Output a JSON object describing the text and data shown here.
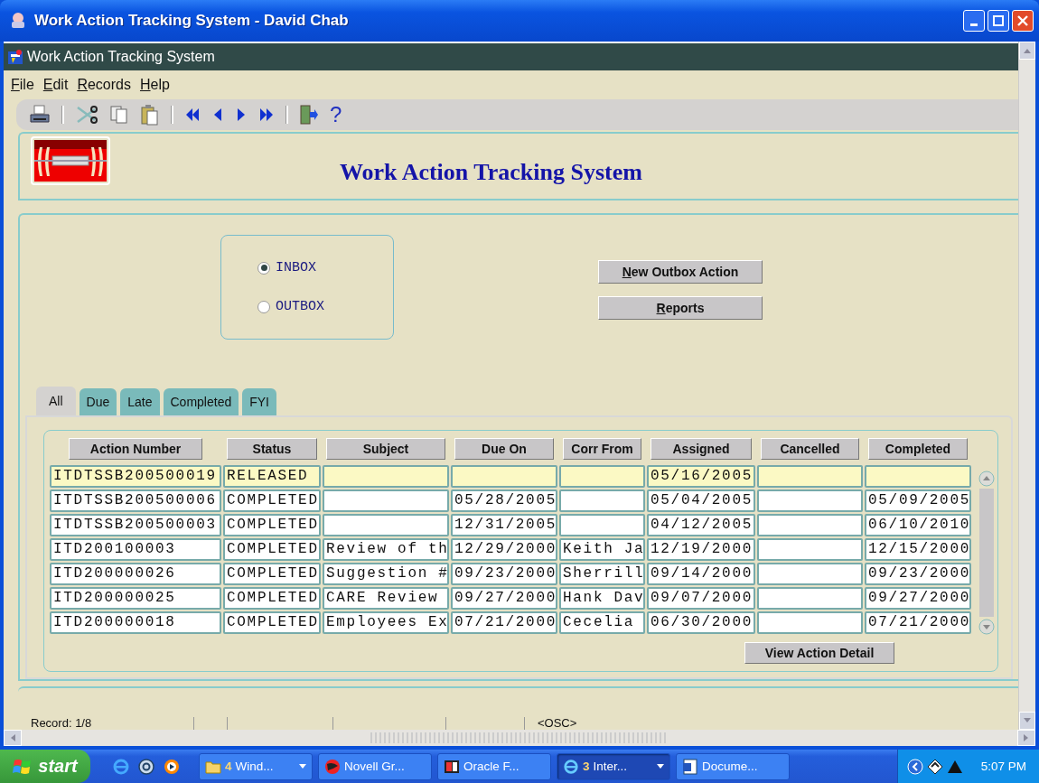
{
  "window": {
    "title": "Work Action Tracking System - David Chab"
  },
  "inner_window": {
    "title": "Work Action Tracking System"
  },
  "menu": [
    "File",
    "Edit",
    "Records",
    "Help"
  ],
  "toolbar": {
    "help_glyph": "?"
  },
  "header": {
    "title": "Work Action Tracking System"
  },
  "mailbox": [
    {
      "label": "INBOX",
      "selected": true
    },
    {
      "label": "OUTBOX",
      "selected": false
    }
  ],
  "buttons": [
    "New Outbox Action",
    "Reports"
  ],
  "tabs": [
    {
      "label": "All",
      "selected": true
    },
    {
      "label": "Due",
      "selected": false
    },
    {
      "label": "Late",
      "selected": false
    },
    {
      "label": "Completed",
      "selected": false
    },
    {
      "label": "FYI",
      "selected": false
    }
  ],
  "table": {
    "columns": [
      "Action Number",
      "Status",
      "Subject",
      "Due On",
      "Corr From",
      "Assigned",
      "Cancelled",
      "Completed"
    ],
    "rows": [
      {
        "selected": true,
        "cells": [
          "ITDTSSB200500019",
          "RELEASED",
          null,
          null,
          null,
          "05/16/2005",
          null,
          null
        ]
      },
      {
        "selected": false,
        "cells": [
          "ITDTSSB200500006",
          "COMPLETED",
          null,
          "05/28/2005",
          null,
          "05/04/2005",
          null,
          "05/09/2005"
        ]
      },
      {
        "selected": false,
        "cells": [
          "ITDTSSB200500003",
          "COMPLETED",
          null,
          "12/31/2005",
          null,
          "04/12/2005",
          null,
          "06/10/2010"
        ]
      },
      {
        "selected": false,
        "cells": [
          "ITD200100003",
          "COMPLETED",
          "Review of th",
          "12/29/2000",
          "Keith Ja",
          "12/19/2000",
          null,
          "12/15/2000"
        ]
      },
      {
        "selected": false,
        "cells": [
          "ITD200000026",
          "COMPLETED",
          "Suggestion #",
          "09/23/2000",
          "Sherrill",
          "09/14/2000",
          null,
          "09/23/2000"
        ]
      },
      {
        "selected": false,
        "cells": [
          "ITD200000025",
          "COMPLETED",
          "CARE Review",
          "09/27/2000",
          "Hank Dav",
          "09/07/2000",
          null,
          "09/27/2000"
        ]
      },
      {
        "selected": false,
        "cells": [
          "ITD200000018",
          "COMPLETED",
          "Employees Ex",
          "07/21/2000",
          "Cecelia",
          "06/30/2000",
          null,
          "07/21/2000"
        ]
      }
    ]
  },
  "detail_button": "View Action Detail",
  "status_bar": {
    "record": "Record: 1/8",
    "mode": "<OSC>"
  },
  "taskbar": {
    "start": "start",
    "tasks": [
      {
        "count": "4",
        "label": "Wind...",
        "dropdown": true,
        "selected": false
      },
      {
        "label": "Novell Gr...",
        "dropdown": false,
        "selected": false
      },
      {
        "label": "Oracle F...",
        "dropdown": false,
        "selected": false
      },
      {
        "count": "3",
        "label": "Inter...",
        "dropdown": true,
        "selected": true
      },
      {
        "label": "Docume...",
        "dropdown": false,
        "selected": false
      }
    ],
    "clock": "5:07 PM"
  }
}
